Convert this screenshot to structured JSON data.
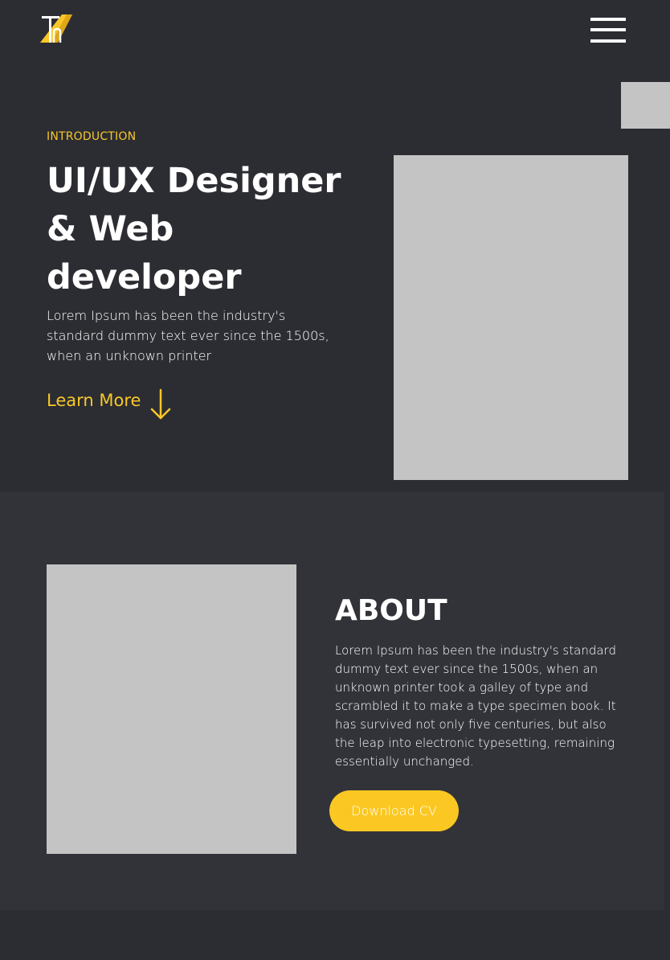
{
  "header": {
    "logo_icon": "th-monogram-logo",
    "menu_icon": "hamburger-menu-icon"
  },
  "hero": {
    "eyebrow": "INTRODUCTION",
    "title": "UI/UX Designer & Web developer",
    "description": "Lorem Ipsum has been the industry's standard dummy text ever since the 1500s, when an unknown printer",
    "cta_label": "Learn More",
    "cta_icon": "arrow-down-icon"
  },
  "about": {
    "title": "ABOUT",
    "description": "Lorem Ipsum has been the industry's standard dummy text ever since the 1500s, when an unknown printer took a galley of type and scrambled it to make a type specimen book. It has survived not only five centuries, but also the leap into electronic typesetting, remaining essentially unchanged.",
    "button_label": "Download CV"
  },
  "colors": {
    "background": "#2c2d32",
    "section_background": "#323339",
    "accent": "#f8c72a",
    "placeholder": "#c4c4c4",
    "text": "#ffffff"
  }
}
